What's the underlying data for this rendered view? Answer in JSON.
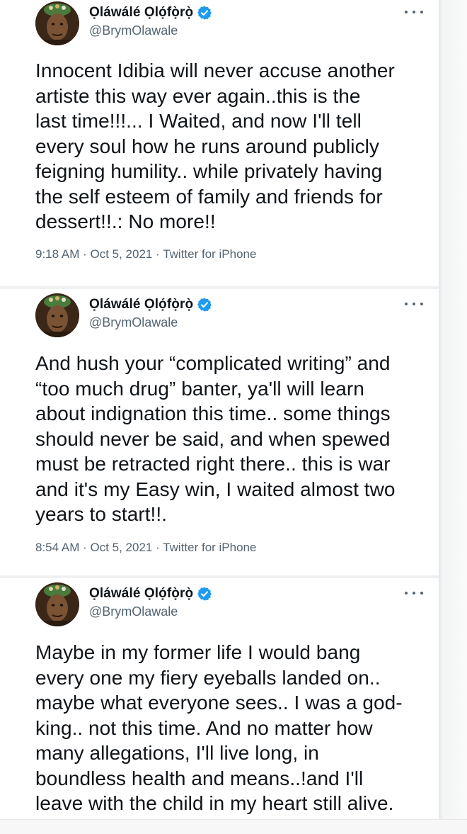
{
  "tweets": [
    {
      "display_name": "Ọláwálé Ọlọ́fọ̀rọ̀",
      "handle": "@BrymOlawale",
      "text": "Innocent Idibia will never accuse another\nartiste this way ever again..this is the\nlast time!!!... I Waited, and now I'll tell\nevery soul how he runs around publicly\nfeigning humility.. while privately having\nthe self esteem of family and friends for\ndessert!!.:  No more!!",
      "time": "9:18 AM",
      "date": "Oct 5, 2021",
      "source": "Twitter for iPhone"
    },
    {
      "display_name": "Ọláwálé Ọlọ́fọ̀rọ̀",
      "handle": "@BrymOlawale",
      "text": "And hush your “complicated writing” and\n“too much drug” banter, ya'll will learn\nabout indignation this time.. some things\nshould never be said, and when spewed\nmust be retracted right there.. this is war\nand it's my Easy win, I waited almost two\nyears to start!!.",
      "time": "8:54 AM",
      "date": "Oct 5, 2021",
      "source": "Twitter for iPhone"
    },
    {
      "display_name": "Ọláwálé Ọlọ́fọ̀rọ̀",
      "handle": "@BrymOlawale",
      "text": "Maybe in my former life I would bang\nevery one my fiery eyeballs landed on..\nmaybe what everyone sees.. I was a god-\nking.. not this time. And no matter how\nmany allegations, I'll live long, in\nboundless health and means..!and I'll\nleave with the child in my heart still alive."
    }
  ],
  "meta_separator": " · ",
  "icons": {
    "verified": "verified-badge-icon",
    "more": "more-dots-icon"
  },
  "colors": {
    "verified_badge": "#1d9bf0",
    "secondary_text": "#536471",
    "primary_text": "#0f1419"
  }
}
